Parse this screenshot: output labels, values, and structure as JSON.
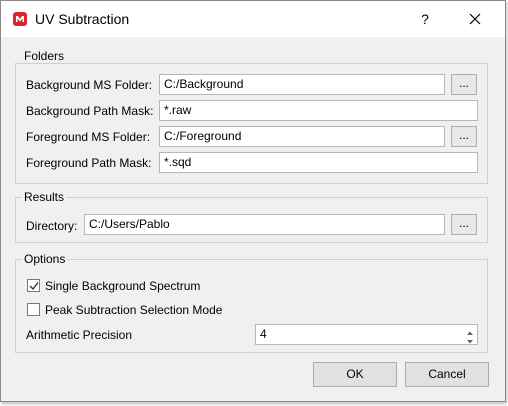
{
  "window": {
    "title": "UV Subtraction",
    "help_label": "?",
    "app_icon": "logo-icon",
    "close_icon": "close-icon"
  },
  "folders": {
    "group_label": "Folders",
    "background_ms_label": "Background MS Folder:",
    "background_ms_value": "C:/Background",
    "background_mask_label": "Background Path Mask:",
    "background_mask_value": "*.raw",
    "foreground_ms_label": "Foreground MS Folder:",
    "foreground_ms_value": "C:/Foreground",
    "foreground_mask_label": "Foreground Path Mask:",
    "foreground_mask_value": "*.sqd",
    "browse_label": "..."
  },
  "results": {
    "group_label": "Results",
    "directory_label": "Directory:",
    "directory_value": "C:/Users/Pablo",
    "browse_label": "..."
  },
  "options": {
    "group_label": "Options",
    "single_background_label": "Single Background Spectrum",
    "single_background_checked": true,
    "peak_subtraction_label": "Peak Subtraction Selection Mode",
    "peak_subtraction_checked": false,
    "precision_label": "Arithmetic Precision",
    "precision_value": "4"
  },
  "buttons": {
    "ok_label": "OK",
    "cancel_label": "Cancel"
  }
}
